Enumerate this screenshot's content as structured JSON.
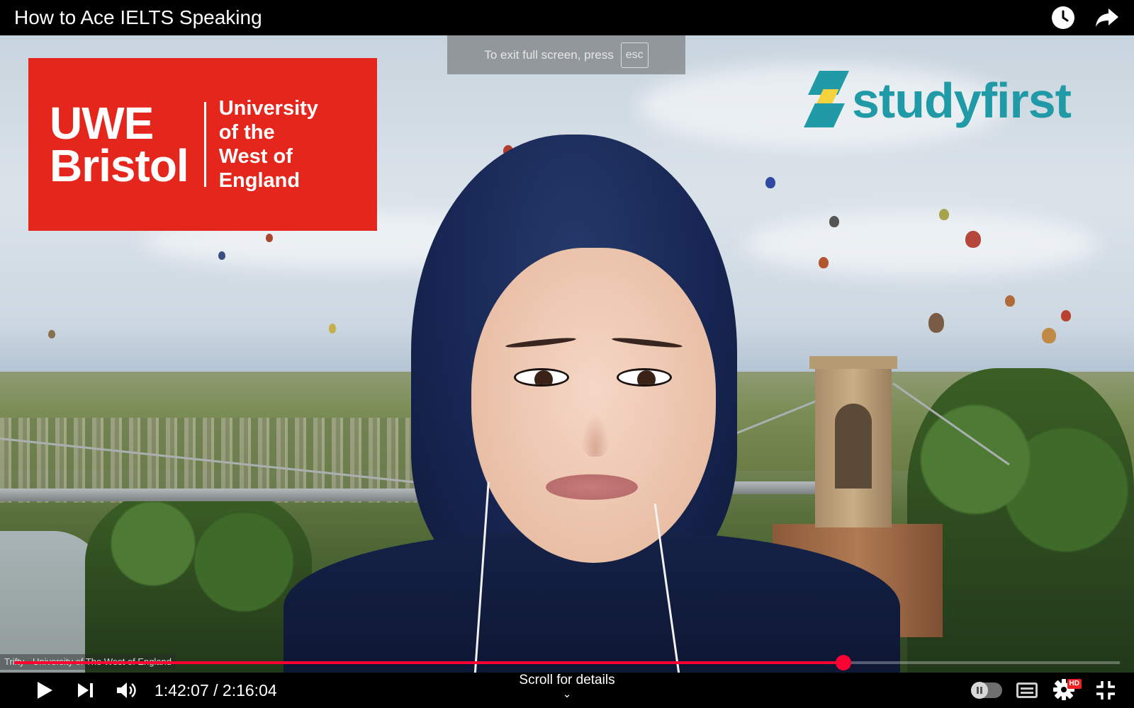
{
  "player": {
    "title": "How to Ace IELTS Speaking",
    "fullscreen_notice": {
      "text": "To exit full screen, press",
      "key": "esc"
    },
    "watermark": "Trifty - University of The West of England",
    "time": {
      "current": "1:42:07",
      "separator": "/",
      "total": "2:16:04"
    },
    "progress_fraction": 0.75,
    "scroll_hint": "Scroll for details",
    "quality_badge": "HD",
    "accent_color": "#ff0033"
  },
  "video_frame": {
    "uwe_logo": {
      "left_line1": "UWE",
      "left_line2": "Bristol",
      "right_line1": "University",
      "right_line2": "of the",
      "right_line3": "West of",
      "right_line4": "England",
      "color": "#e5261d"
    },
    "studyfirst_logo": {
      "text": "studyfirst",
      "color": "#1f9aa6",
      "accent": "#f3d23c"
    }
  },
  "icons": {
    "clock": "clock-icon",
    "share": "share-icon",
    "play": "play-icon",
    "next": "next-icon",
    "volume": "volume-icon",
    "autoplay": "autoplay-toggle",
    "captions": "captions-icon",
    "settings": "gear-icon",
    "exit_fullscreen": "exit-fullscreen-icon"
  }
}
